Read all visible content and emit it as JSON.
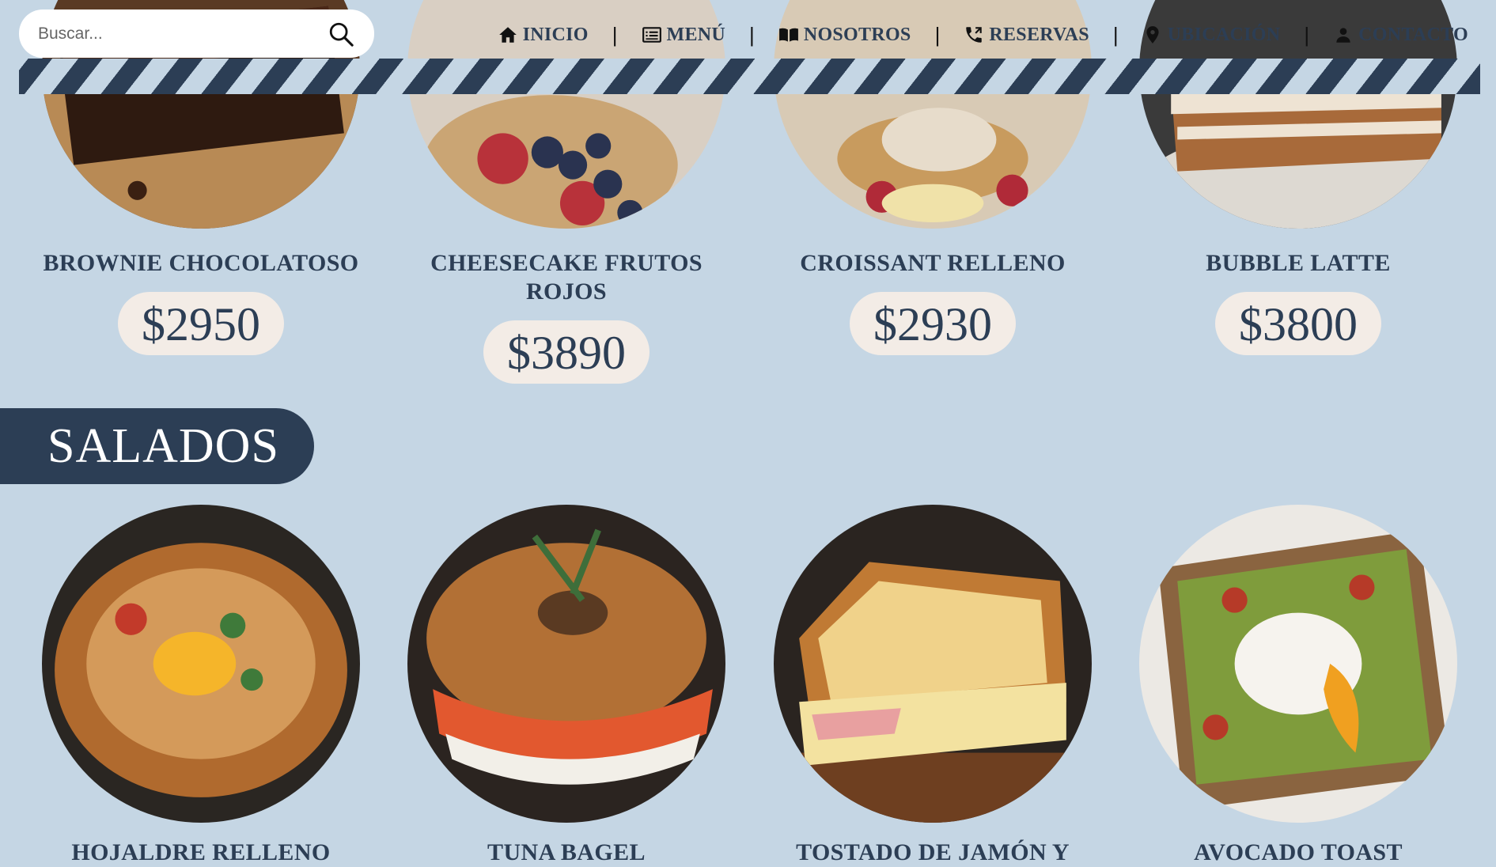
{
  "search": {
    "placeholder": "Buscar..."
  },
  "nav": [
    {
      "label": "INICIO",
      "icon": "home-icon"
    },
    {
      "label": "MENÚ",
      "icon": "menu-list-icon"
    },
    {
      "label": "NOSOTROS",
      "icon": "book-icon"
    },
    {
      "label": "RESERVAS",
      "icon": "phone-icon"
    },
    {
      "label": "UBICACIÓN",
      "icon": "location-pin-icon"
    },
    {
      "label": "CONTACTO",
      "icon": "user-icon"
    }
  ],
  "nav_separator": "|",
  "sweets": [
    {
      "name": "BROWNIE CHOCOLATOSO",
      "price": "$2950"
    },
    {
      "name": "CHEESECAKE FRUTOS ROJOS",
      "price": "$3890"
    },
    {
      "name": "CROISSANT RELLENO",
      "price": "$2930"
    },
    {
      "name": "BUBBLE LATTE",
      "price": "$3800"
    }
  ],
  "section_salados": "SALADOS",
  "salados": [
    {
      "name": "HOJALDRE RELLENO"
    },
    {
      "name": "TUNA BAGEL"
    },
    {
      "name": "TOSTADO DE JAMÓN Y"
    },
    {
      "name": "AVOCADO TOAST"
    }
  ],
  "colors": {
    "background": "#c5d6e4",
    "navy": "#2c3e55",
    "price_pill": "#f3ece6"
  }
}
